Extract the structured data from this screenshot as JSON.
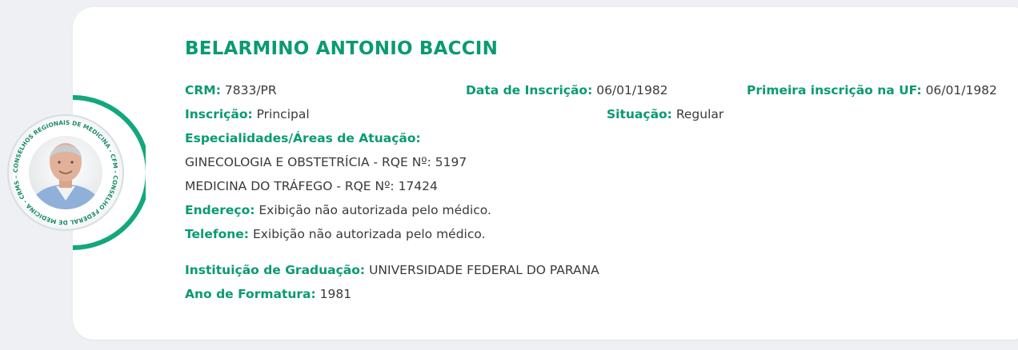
{
  "doctor": {
    "name": "BELARMINO ANTONIO BACCIN",
    "crm_label": "CRM:",
    "crm_value": "7833/PR",
    "data_inscricao_label": "Data de Inscrição:",
    "data_inscricao_value": "06/01/1982",
    "primeira_inscricao_label": "Primeira inscrição na UF:",
    "primeira_inscricao_value": "06/01/1982",
    "inscricao_label": "Inscrição:",
    "inscricao_value": "Principal",
    "situacao_label": "Situação:",
    "situacao_value": "Regular",
    "especialidades_label": "Especialidades/Áreas de Atuação:",
    "especialidades": [
      "GINECOLOGIA E OBSTETRÍCIA - RQE Nº: 5197",
      "MEDICINA DO TRÁFEGO - RQE Nº: 17424"
    ],
    "endereco_label": "Endereço:",
    "endereco_value": "Exibição não autorizada pelo médico.",
    "telefone_label": "Telefone:",
    "telefone_value": "Exibição não autorizada pelo médico.",
    "instituicao_label": "Instituição de Graduação:",
    "instituicao_value": "UNIVERSIDADE FEDERAL DO PARANA",
    "ano_formatura_label": "Ano de Formatura:",
    "ano_formatura_value": "1981"
  },
  "seal": {
    "ring_text": "CONSELHOS REGIONAIS DE MEDICINA - CFM - CONSELHO FEDERAL DE MEDICINA - CRMS -"
  },
  "colors": {
    "accent": "#0a9a72",
    "text": "#3a3a3a",
    "ring": "#13a77d"
  }
}
